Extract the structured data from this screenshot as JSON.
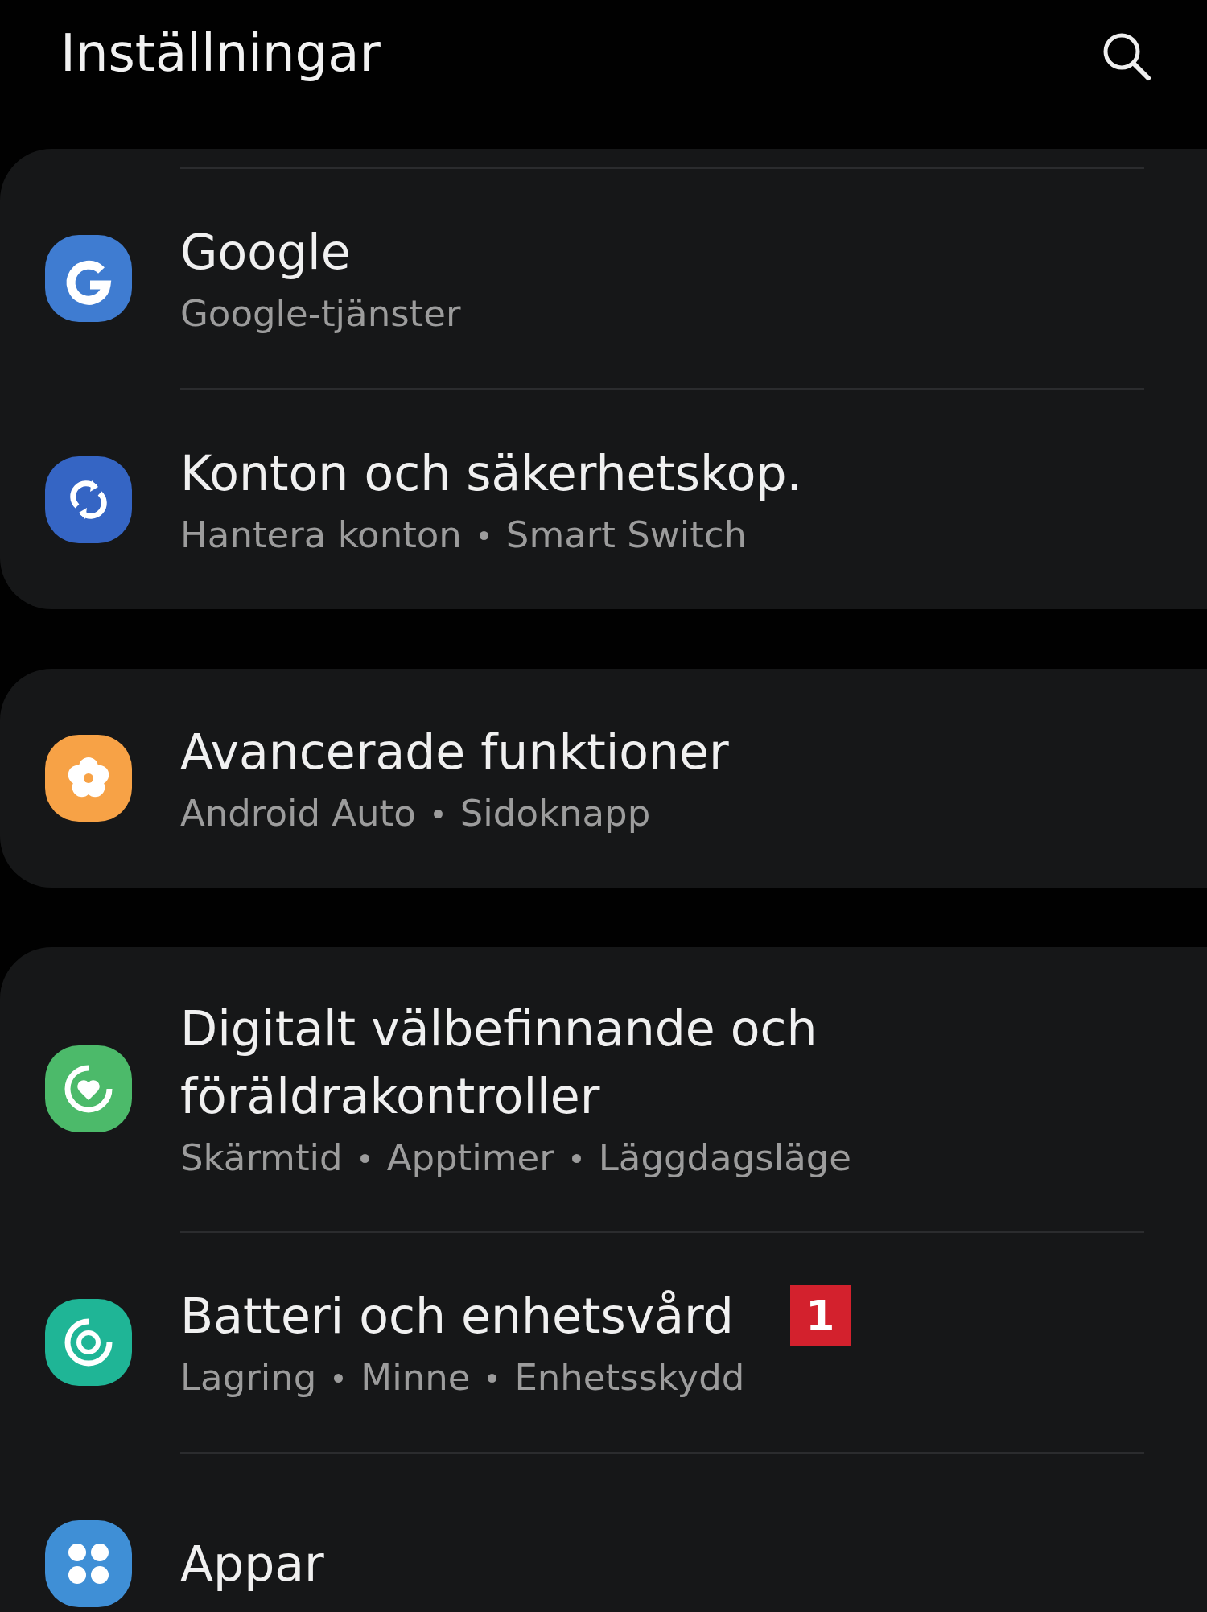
{
  "header": {
    "title": "Inställningar"
  },
  "groups": [
    {
      "items": [
        {
          "title": "Google",
          "details": [
            "Google-tjänster"
          ],
          "color": "#3f7cd1"
        },
        {
          "title": "Konton och säkerhetskop.",
          "details": [
            "Hantera konton",
            "Smart Switch"
          ],
          "color": "#3565c4"
        }
      ]
    },
    {
      "items": [
        {
          "title": "Avancerade funktioner",
          "details": [
            "Android Auto",
            "Sidoknapp"
          ],
          "color": "#f7a246"
        }
      ]
    },
    {
      "items": [
        {
          "title": "Digitalt välbefinnande och föräldrakontroller",
          "details": [
            "Skärmtid",
            "Apptimer",
            "Läggdagsläge"
          ],
          "color": "#4cba6a"
        },
        {
          "title": "Batteri och enhetsvård",
          "badge": "1",
          "details": [
            "Lagring",
            "Minne",
            "Enhetsskydd"
          ],
          "color": "#1fb596"
        },
        {
          "title": "Appar",
          "color": "#3f8fd6"
        }
      ]
    }
  ]
}
